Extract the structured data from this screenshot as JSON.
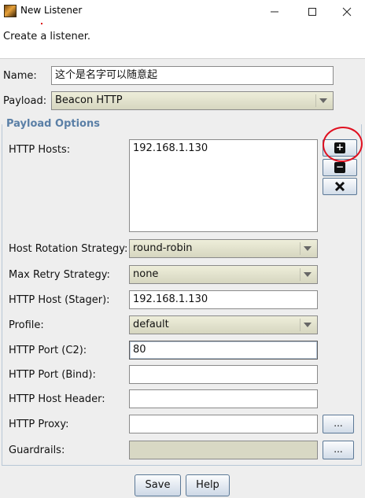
{
  "window": {
    "title": "New Listener",
    "app_icon": "cobalt-strike-icon",
    "controls": [
      "minimize-icon",
      "maximize-icon",
      "close-icon"
    ]
  },
  "description": "Create a listener.",
  "form": {
    "name_label": "Name:",
    "name_value": "这个是名字可以随意起",
    "payload_label": "Payload:",
    "payload_value": "Beacon HTTP"
  },
  "payload_options": {
    "title": "Payload Options",
    "http_hosts_label": "HTTP Hosts:",
    "http_hosts": [
      "192.168.1.130"
    ],
    "add_host_icon": "plus-icon",
    "remove_host_icon": "minus-icon",
    "clear_hosts_icon": "x-icon",
    "host_rotation_label": "Host Rotation Strategy:",
    "host_rotation_value": "round-robin",
    "max_retry_label": "Max Retry Strategy:",
    "max_retry_value": "none",
    "http_host_stager_label": "HTTP Host (Stager):",
    "http_host_stager_value": "192.168.1.130",
    "profile_label": "Profile:",
    "profile_value": "default",
    "http_port_c2_label": "HTTP Port (C2):",
    "http_port_c2_value": "80",
    "http_port_bind_label": "HTTP Port (Bind):",
    "http_port_bind_value": "",
    "http_host_header_label": "HTTP Host Header:",
    "http_host_header_value": "",
    "http_proxy_label": "HTTP Proxy:",
    "http_proxy_value": "",
    "guardrails_label": "Guardrails:",
    "guardrails_value": "",
    "browse_label": "..."
  },
  "buttons": {
    "save": "Save",
    "help": "Help"
  },
  "colors": {
    "section_title": "#5a7fa6",
    "annotation": "#e01020"
  }
}
